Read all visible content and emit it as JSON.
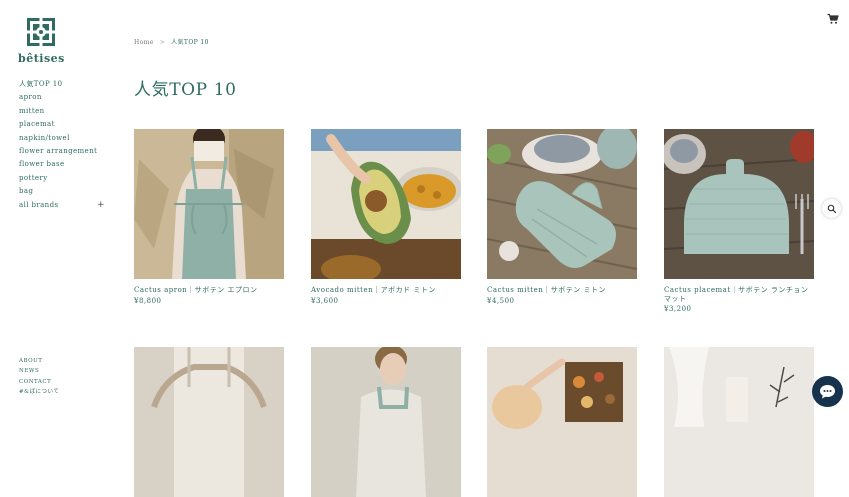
{
  "brand": {
    "name": "bêtises"
  },
  "sidebar": {
    "items": [
      {
        "label": "人気TOP 10"
      },
      {
        "label": "apron"
      },
      {
        "label": "mitten"
      },
      {
        "label": "placemat"
      },
      {
        "label": "napkin/towel"
      },
      {
        "label": "flower arrangement"
      },
      {
        "label": "flower base"
      },
      {
        "label": "pottery"
      },
      {
        "label": "bag"
      },
      {
        "label": "all brands",
        "expand_symbol": "+"
      }
    ]
  },
  "footer": {
    "links": [
      {
        "label": "ABOUT"
      },
      {
        "label": "NEWS"
      },
      {
        "label": "CONTACT"
      },
      {
        "label": "#&ばについて"
      }
    ]
  },
  "breadcrumb": {
    "home": "Home",
    "separator": ">",
    "current": "人気TOP 10"
  },
  "page": {
    "title": "人気TOP 10"
  },
  "products": [
    {
      "name": "Cactus apron｜サボテン エプロン",
      "price": "¥8,800"
    },
    {
      "name": "Avocado mitten｜アボカド ミトン",
      "price": "¥3,600"
    },
    {
      "name": "Cactus mitten｜サボテン ミトン",
      "price": "¥4,500"
    },
    {
      "name": "Cactus placemat｜サボテン ランチョンマット",
      "price": "¥3,200"
    }
  ],
  "icons": {
    "cart": "cart-icon",
    "search": "search-icon",
    "chat": "chat-icon"
  },
  "colors": {
    "brand": "#2f6b62",
    "chat_bg": "#17324d"
  }
}
